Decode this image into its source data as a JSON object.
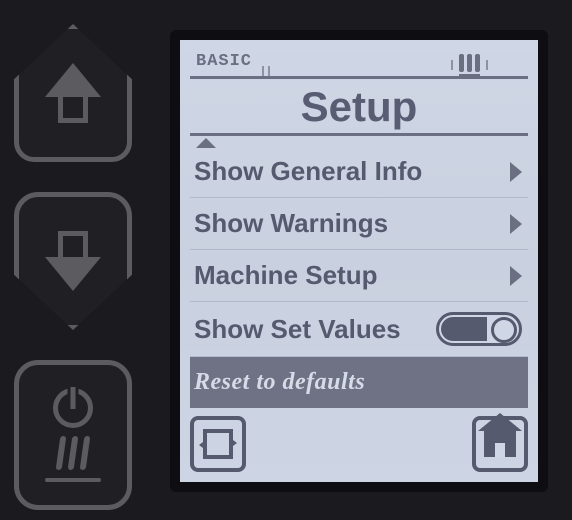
{
  "hardware_buttons": {
    "up": "nav-up",
    "down": "nav-down",
    "power_heat": "power-heat"
  },
  "tabbar": {
    "mode_label": "BASIC",
    "active_icon": "heat-icon"
  },
  "screen": {
    "title": "Setup"
  },
  "menu": {
    "items": [
      {
        "label": "Show General Info",
        "type": "submenu"
      },
      {
        "label": "Show Warnings",
        "type": "submenu"
      },
      {
        "label": "Machine Setup",
        "type": "submenu"
      },
      {
        "label": "Show Set Values",
        "type": "toggle",
        "value": "on"
      },
      {
        "label": "Reset to defaults",
        "type": "action",
        "highlighted": true
      }
    ]
  },
  "footer": {
    "left": "cycle",
    "right": "home"
  }
}
